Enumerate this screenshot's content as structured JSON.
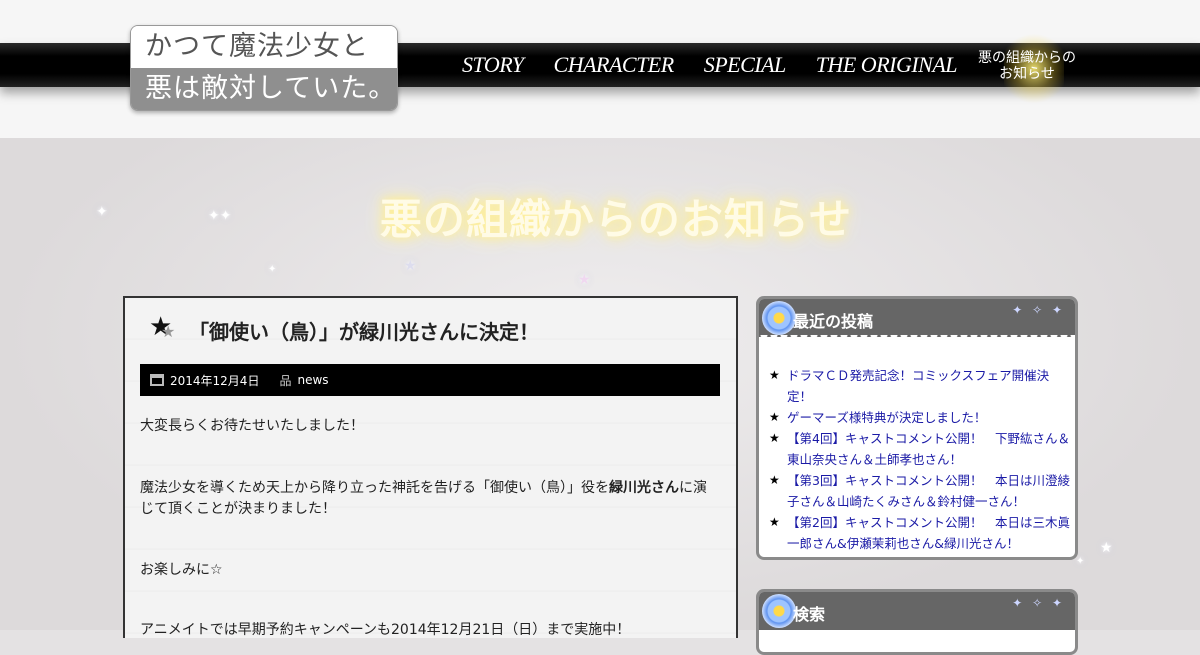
{
  "site": {
    "logo_line1": "かつて魔法少女と",
    "logo_line2": "悪は敵対していた。"
  },
  "nav": {
    "items": [
      "STORY",
      "CHARACTER",
      "SPECIAL",
      "THE ORIGINAL"
    ],
    "news_label": "悪の組織からのお知らせ"
  },
  "banner": {
    "title": "悪の組織からのお知らせ"
  },
  "article": {
    "title": "「御使い（鳥）」が緑川光さんに決定！",
    "date": "2014年12月4日",
    "category": "news",
    "p1": "大変長らくお待たせいたしました！",
    "p2_before": "魔法少女を導くため天上から降り立った神託を告げる「御使い（鳥）」役を",
    "p2_bold": "緑川光さん",
    "p2_after": "に演じて頂くことが決まりました！",
    "p3": "お楽しみに☆",
    "p4": "アニメイトでは早期予約キャンペーンも2014年12月21日（日）まで実施中！"
  },
  "sidebar": {
    "recent_title": "最近の投稿",
    "recent_posts": [
      "ドラマＣＤ発売記念！コミックスフェア開催決定！",
      "ゲーマーズ様特典が決定しました！",
      "【第4回】キャストコメント公開！　下野紘さん＆東山奈央さん＆土師孝也さん！",
      "【第3回】キャストコメント公開！　本日は川澄綾子さん＆山崎たくみさん＆鈴村健一さん！",
      "【第2回】キャストコメント公開！　本日は三木眞一郎さん&伊瀬茉莉也さん&緑川光さん！"
    ],
    "search_title": "検索"
  },
  "icons": {
    "calendar": "calendar-icon",
    "category": "category-tree-icon",
    "star": "star-icon",
    "flower": "flower-icon"
  },
  "colors": {
    "navbar": "#000000",
    "link": "#1a1aa6",
    "widget_head": "#666666",
    "banner_title": "#fffbe6"
  }
}
